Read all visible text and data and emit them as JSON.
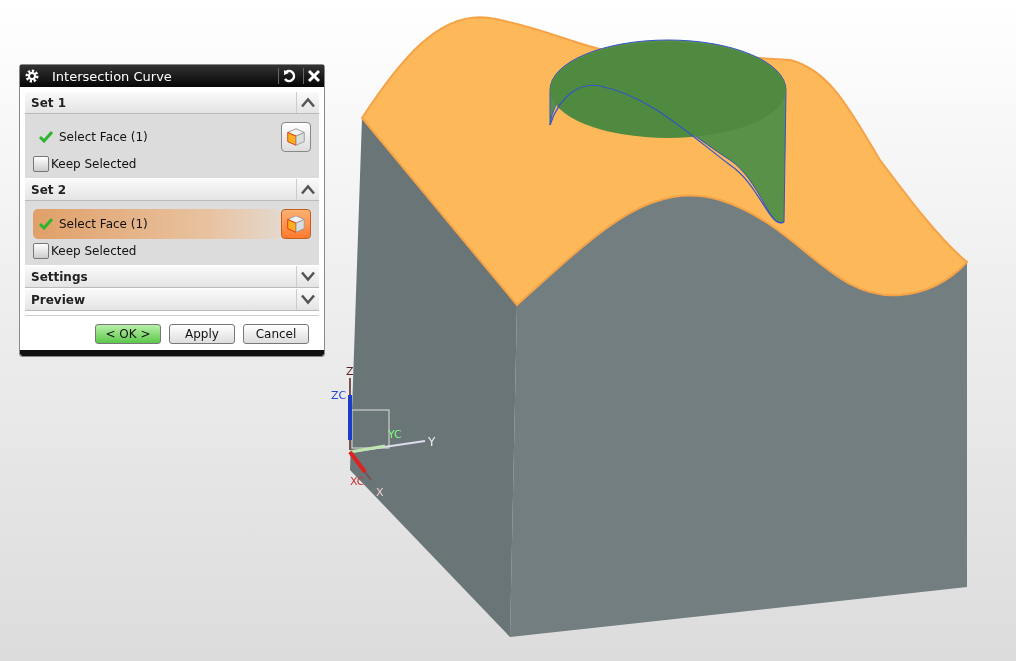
{
  "dialog": {
    "title": "Intersection Curve",
    "groups": [
      {
        "title": "Set 1",
        "expanded": true,
        "select": {
          "label": "Select Face (1)",
          "done": true,
          "selected": false
        },
        "keep": {
          "label": "Keep Selected",
          "checked": false
        }
      },
      {
        "title": "Set 2",
        "expanded": true,
        "select": {
          "label": "Select Face (1)",
          "done": true,
          "selected": true
        },
        "keep": {
          "label": "Keep Selected",
          "checked": false
        }
      },
      {
        "title": "Settings",
        "expanded": false
      },
      {
        "title": "Preview",
        "expanded": false
      }
    ],
    "buttons": [
      {
        "label": "< OK >",
        "kind": "default"
      },
      {
        "label": "Apply",
        "kind": "normal"
      },
      {
        "label": "Cancel",
        "kind": "normal"
      }
    ]
  },
  "triad": {
    "z": "Z",
    "zc": "ZC",
    "y": "Y",
    "yc": "YC",
    "x": "X",
    "xc": "XC"
  }
}
